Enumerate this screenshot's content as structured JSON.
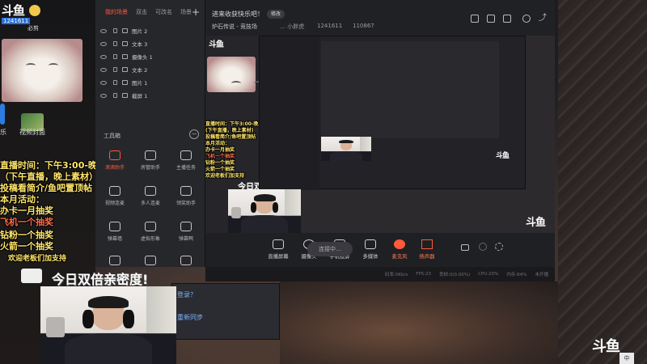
{
  "overlay": {
    "logo_small": "斗鱼",
    "viewer_count": "1241611",
    "user_tag": "必剪",
    "desktop_icon_label_1": "乐",
    "desktop_icon_label_2": "视频封面",
    "schedule_lines": [
      "直播时间：下午3:00-晚上10:00",
      "（下午直播，晚上素材）",
      "投稿看简介/鱼吧置顶帖",
      "本月活动：",
      "办卡一月抽奖",
      "飞机一个抽奖",
      "钻粉一个抽奖",
      "火箭一个抽奖",
      "欢迎老板们加支持"
    ],
    "double_intimacy": "今日双倍亲密度!",
    "watermark": "斗鱼"
  },
  "panel": {
    "tabs": [
      "我的场景",
      "双击",
      "可改名",
      "场景"
    ],
    "sources": [
      "图片 2",
      "文本 3",
      "摄像头 1",
      "文本 2",
      "图片 1",
      "截屏 1"
    ],
    "toolbox_title": "工具箱",
    "tools": [
      {
        "label": "滴滴助手",
        "red": true
      },
      {
        "label": "房管助手",
        "red": false
      },
      {
        "label": "主播任务",
        "red": false
      },
      {
        "label": "视频连麦",
        "red": false
      },
      {
        "label": "多人连麦",
        "red": false
      },
      {
        "label": "领奖助手",
        "red": false
      },
      {
        "label": "弹幕墙",
        "red": false
      },
      {
        "label": "虚拟形象",
        "red": false
      },
      {
        "label": "弹幕鸭",
        "red": false
      },
      {
        "label": "",
        "red": false
      },
      {
        "label": "",
        "red": false
      },
      {
        "label": "",
        "red": false
      }
    ]
  },
  "topbar": {
    "title": "进来收获快乐吧！",
    "edit_button": "修改",
    "category": "炉石传说 - 竞技场",
    "streamer": "… 小胖虎",
    "room_id": "1241611",
    "heat": "110867"
  },
  "preview": {
    "caption_small": "今日双倍亲密度!",
    "nested_schedule_lines": [
      "直播时间：下午3:00-晚上10:00",
      "(下午直播，晚上素材)",
      "投稿看简介/鱼吧置顶帖",
      "本月活动：",
      "办卡一月抽奖",
      "飞机一个抽奖",
      "钻粉一个抽奖",
      "火箭一个抽奖",
      "欢迎老板们加支持"
    ],
    "nested_watermark": "斗鱼"
  },
  "bottombar": {
    "buttons": [
      {
        "label": "直播屏幕",
        "red": false
      },
      {
        "label": "摄像头",
        "red": false
      },
      {
        "label": "手机投屏",
        "red": false
      },
      {
        "label": "多媒体",
        "red": false
      },
      {
        "label": "麦克风",
        "red": true
      },
      {
        "label": "扬声器",
        "red": true
      }
    ],
    "go_live": "连接中…"
  },
  "status": {
    "items": [
      "码率:0Kb/s",
      "FPS:23",
      "丢帧:0(0.00%)",
      "CPU:20%",
      "内存:64%",
      "未开播"
    ]
  },
  "chat": {
    "line1": "登录？",
    "line2": "重新同步"
  },
  "taskbar": {
    "ime": "中"
  },
  "colors": {
    "accent": "#ff5a3a",
    "overlay_yellow": "#ffe66b",
    "panel_bg": "#26272b"
  }
}
